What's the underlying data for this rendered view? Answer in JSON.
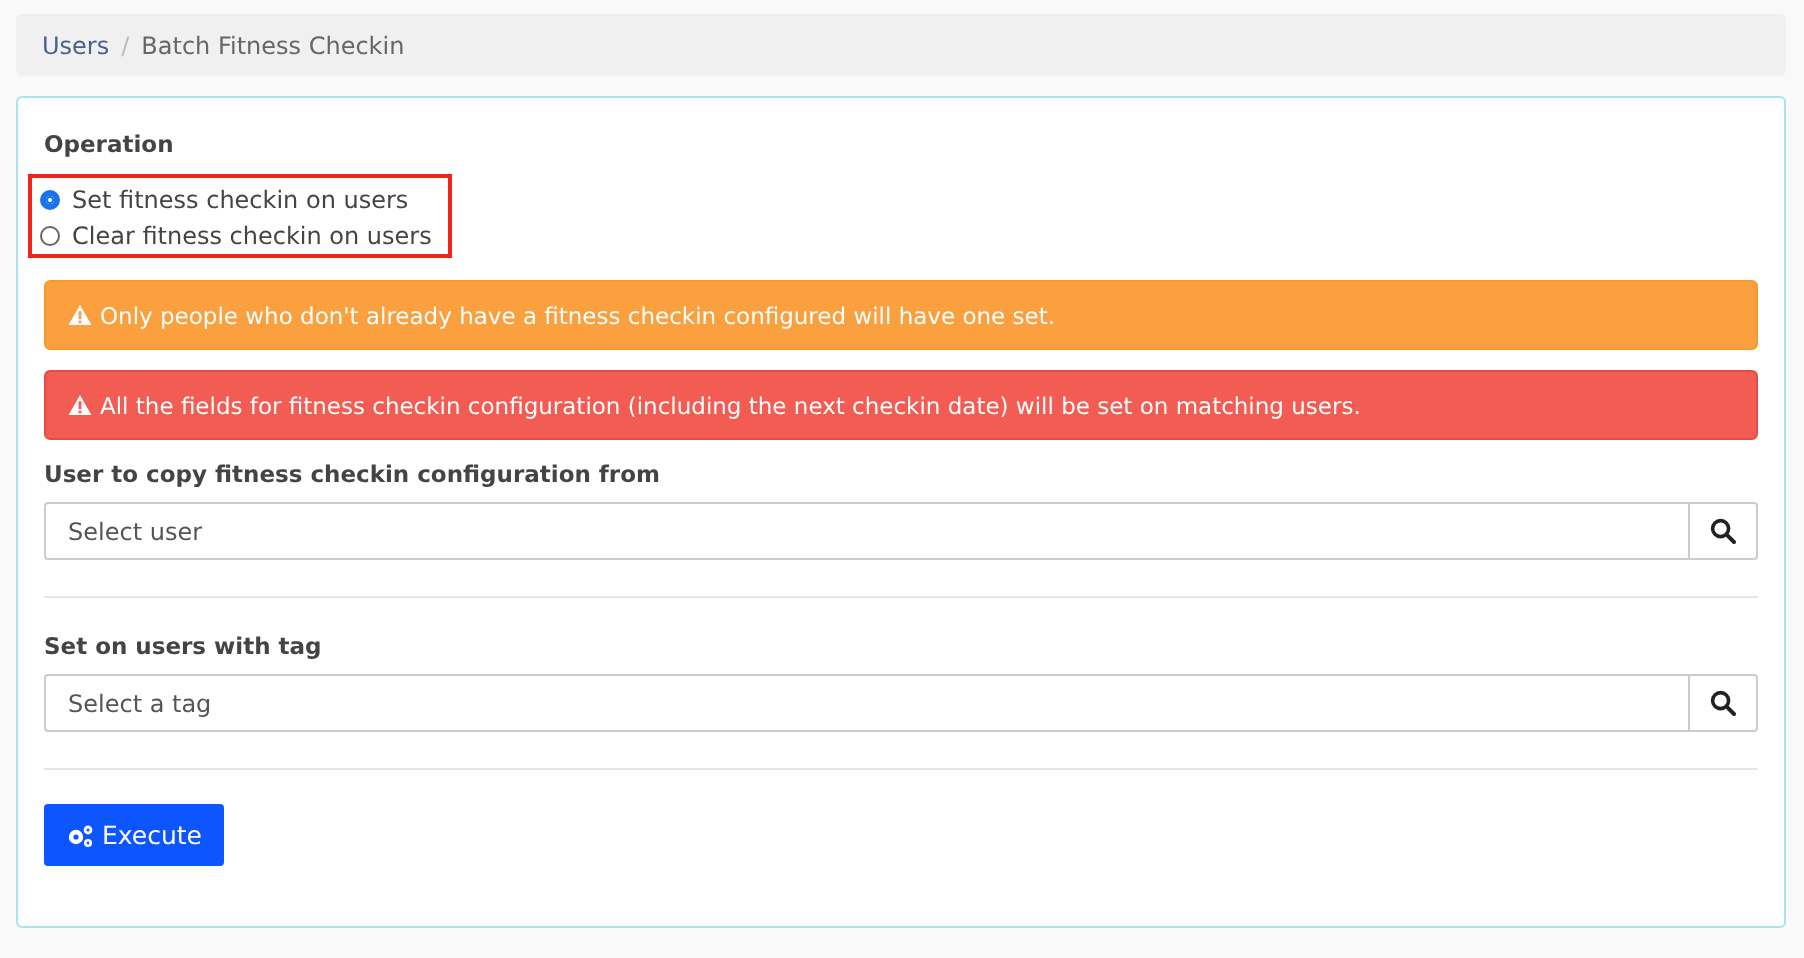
{
  "breadcrumb": {
    "separator": "/",
    "items": [
      {
        "label": "Users",
        "kind": "link"
      },
      {
        "label": "Batch Fitness Checkin",
        "kind": "current"
      }
    ]
  },
  "operation": {
    "label": "Operation",
    "options": [
      {
        "label": "Set fitness checkin on users",
        "selected": true
      },
      {
        "label": "Clear fitness checkin on users",
        "selected": false
      }
    ]
  },
  "alerts": [
    {
      "kind": "warning",
      "text": "Only people who don't already have a fitness checkin configured will have one set."
    },
    {
      "kind": "danger",
      "text": "All the fields for fitness checkin configuration (including the next checkin date) will be set on matching users."
    }
  ],
  "fields": [
    {
      "label": "User to copy fitness checkin configuration from",
      "placeholder": "Select user"
    },
    {
      "label": "Set on users with tag",
      "placeholder": "Select a tag"
    }
  ],
  "button": {
    "label": "Execute"
  }
}
